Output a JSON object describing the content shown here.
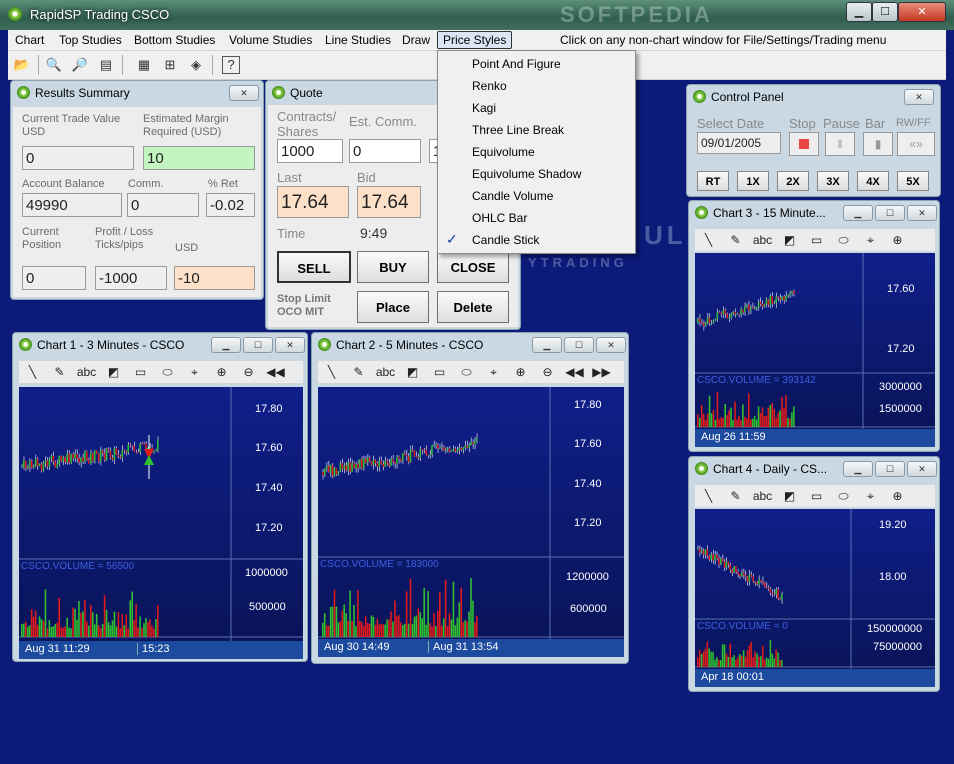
{
  "window": {
    "title": "RapidSP Trading CSCO",
    "min": "▁",
    "max": "☐",
    "close": "✕"
  },
  "menu": {
    "items": [
      "Chart",
      "Top Studies",
      "Bottom Studies",
      "Volume Studies",
      "Line Studies",
      "Draw",
      "Price Styles"
    ],
    "hint": "Click on any non-chart window for File/Settings/Trading menu"
  },
  "price_styles": {
    "options": [
      "Point And Figure",
      "Renko",
      "Kagi",
      "Three Line Break",
      "Equivolume",
      "Equivolume Shadow",
      "Candle Volume",
      "OHLC Bar",
      "Candle Stick"
    ],
    "checked": "Candle Stick"
  },
  "watermark": {
    "text": "SOFTPEDIA",
    "brand": "YTRADING",
    "brand2": "ULA"
  },
  "results": {
    "title": "Results Summary",
    "labels": {
      "trade_value": "Current Trade Value USD",
      "margin": "Estimated Margin Required (USD)",
      "balance": "Account Balance",
      "comm": "Comm.",
      "ret": "% Ret",
      "position": "Current Position",
      "pl": "Profit / Loss Ticks/pips",
      "usd": "USD"
    },
    "values": {
      "trade_value": "0",
      "margin": "10",
      "balance": "49990",
      "comm": "0",
      "ret": "-0.02",
      "position": "0",
      "ticks": "-1000",
      "usd": "-10"
    }
  },
  "quote": {
    "title": "Quote",
    "labels": {
      "contracts": "Contracts/ Shares",
      "est_comm": "Est. Comm.",
      "last": "Last",
      "bid": "Bid",
      "time": "Time",
      "stop": "Stop Limit OCO MIT"
    },
    "values": {
      "contracts": "1000",
      "est_comm": "0",
      "third": "1",
      "last": "17.64",
      "bid": "17.64",
      "time": "9:49"
    },
    "buttons": {
      "sell": "SELL",
      "buy": "BUY",
      "close": "CLOSE",
      "place": "Place",
      "delete": "Delete"
    }
  },
  "control": {
    "title": "Control Panel",
    "labels": {
      "date": "Select Date",
      "stop": "Stop",
      "pause": "Pause",
      "bar": "Bar",
      "rwff": "RW/FF"
    },
    "date": "09/01/2005",
    "speeds": [
      "RT",
      "1X",
      "2X",
      "3X",
      "4X",
      "5X"
    ]
  },
  "charts": {
    "c1": {
      "title": "Chart 1 -  3 Minutes - CSCO",
      "prices": [
        "17.80",
        "17.60",
        "17.40",
        "17.20"
      ],
      "vol_label": "CSCO.VOLUME = 56500",
      "vols": [
        "1000000",
        "500000"
      ],
      "footer": [
        "Aug 31 11:29",
        "15:23"
      ]
    },
    "c2": {
      "title": "Chart 2 -  5 Minutes - CSCO",
      "prices": [
        "17.80",
        "17.60",
        "17.40",
        "17.20"
      ],
      "vol_label": "CSCO.VOLUME = 183000",
      "vols": [
        "1200000",
        "600000"
      ],
      "footer": [
        "Aug 30 14:49",
        "Aug 31 13:54"
      ]
    },
    "c3": {
      "title": "Chart 3 -  15 Minute...",
      "prices": [
        "17.60",
        "17.20"
      ],
      "vol_label": "CSCO.VOLUME = 393142",
      "vols": [
        "3000000",
        "1500000"
      ],
      "footer": [
        "Aug 26 11:59"
      ]
    },
    "c4": {
      "title": "Chart 4 - Daily - CS...",
      "prices": [
        "19.20",
        "18.00"
      ],
      "vol_label": "CSCO.VOLUME = 0",
      "vols": [
        "150000000",
        "75000000"
      ],
      "footer": [
        "Apr 18 00:01"
      ]
    }
  },
  "colors": {
    "up": "#2fc12f",
    "down": "#e21a1a",
    "desk": "#0c1a7a"
  }
}
